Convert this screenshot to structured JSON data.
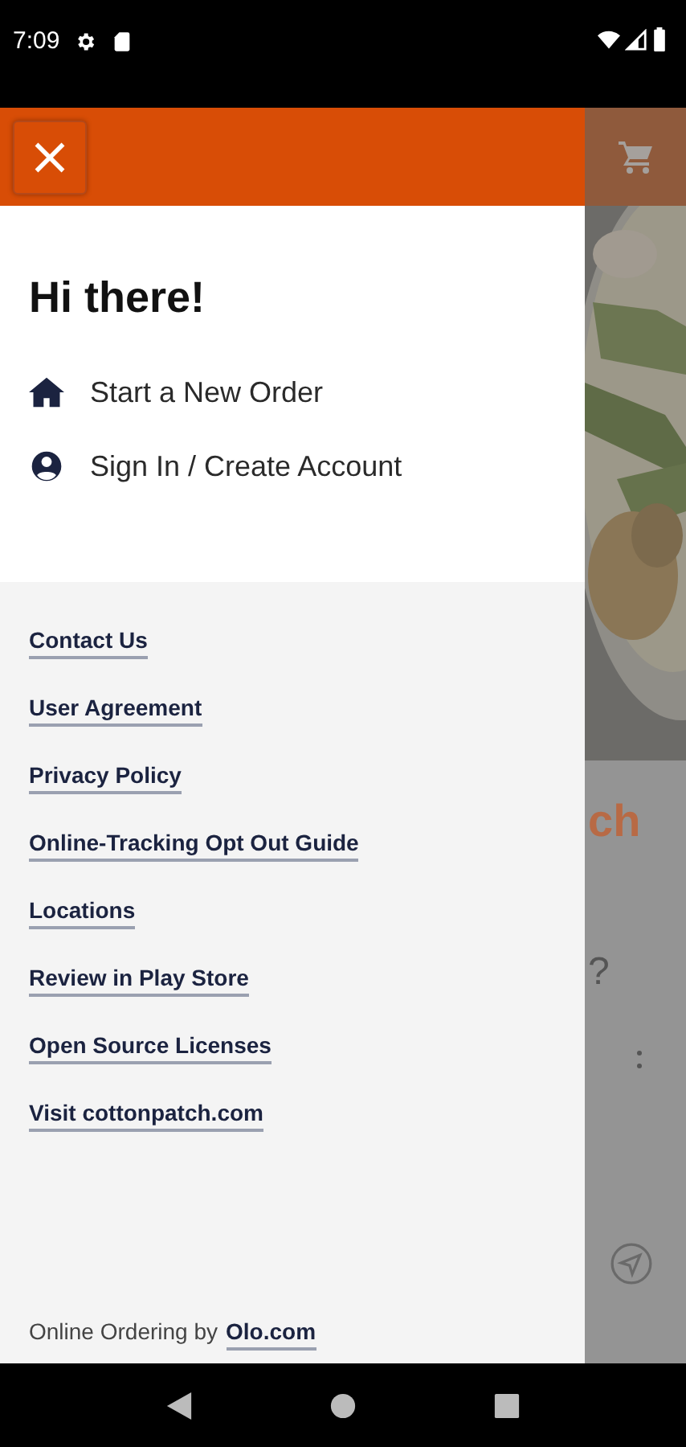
{
  "status_bar": {
    "time": "7:09"
  },
  "drawer": {
    "greeting": "Hi there!",
    "actions": [
      {
        "kind": "home",
        "label": "Start a New Order"
      },
      {
        "kind": "account",
        "label": "Sign In / Create Account"
      }
    ],
    "links": [
      "Contact Us",
      "User Agreement",
      "Privacy Policy",
      "Online-Tracking Opt Out Guide",
      "Locations",
      "Review in Play Store",
      "Open Source Licenses",
      "Visit cottonpatch.com"
    ],
    "footer": {
      "text": "Online Ordering by",
      "link": "Olo.com"
    }
  },
  "background": {
    "heading_fragment": "ch",
    "question_fragment": "?"
  }
}
